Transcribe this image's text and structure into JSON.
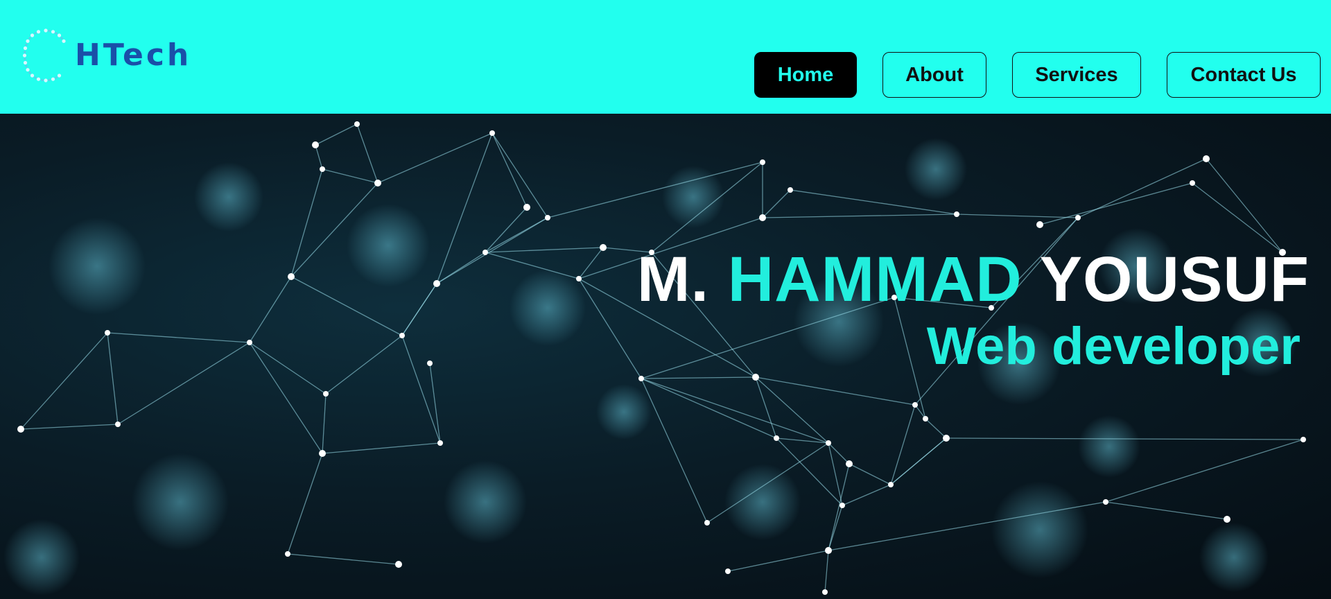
{
  "header": {
    "background": "#22ffee",
    "logo": {
      "text": "HTech",
      "icon": "dotted-circle-icon",
      "color": "#1a4fa8"
    },
    "nav": {
      "items": [
        {
          "label": "Home",
          "active": true
        },
        {
          "label": "About",
          "active": false
        },
        {
          "label": "Services",
          "active": false
        },
        {
          "label": "Contact Us",
          "active": false
        }
      ]
    }
  },
  "hero": {
    "background_image": "network-constellation-background",
    "name": {
      "first": "M.",
      "middle": "HAMMAD",
      "last": "YOUSUF"
    },
    "role": "Web developer",
    "accent_color": "#22eedd",
    "text_color": "#ffffff"
  }
}
